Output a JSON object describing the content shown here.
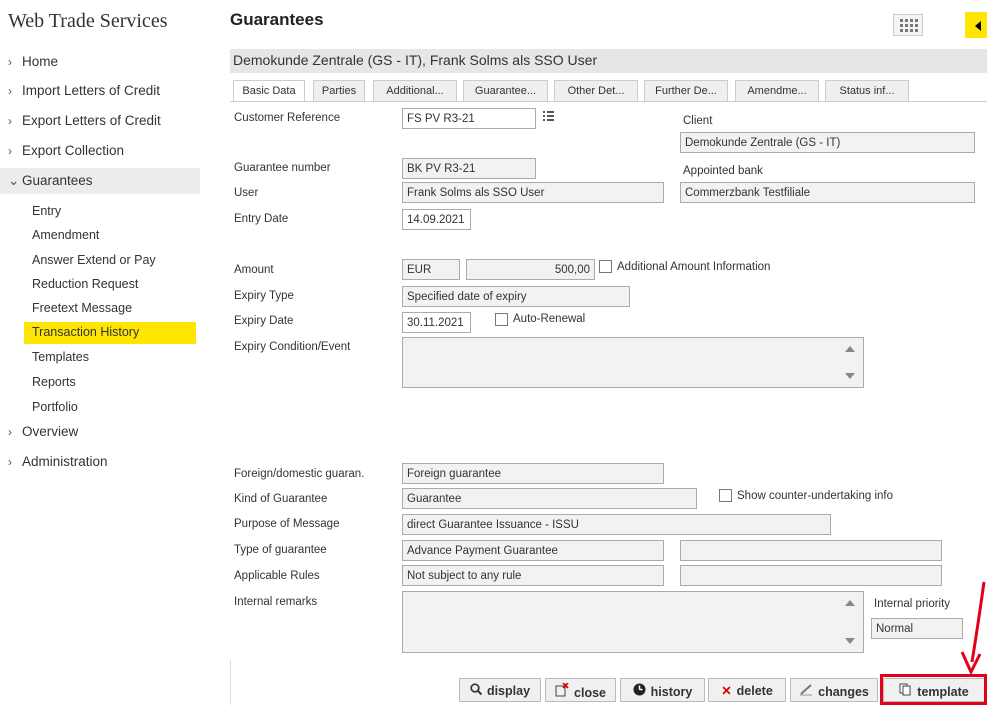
{
  "app_title": "Web Trade Services",
  "page_title": "Guarantees",
  "customer_bar": "Demokunde Zentrale (GS - IT), Frank Solms als SSO User",
  "sidebar": {
    "top_items": [
      {
        "label": "Home"
      },
      {
        "label": "Import Letters of Credit"
      },
      {
        "label": "Export Letters of Credit"
      },
      {
        "label": "Export Collection"
      }
    ],
    "group": {
      "label": "Guarantees"
    },
    "sub_items": [
      {
        "label": "Entry"
      },
      {
        "label": "Amendment"
      },
      {
        "label": "Answer Extend or Pay"
      },
      {
        "label": "Reduction Request"
      },
      {
        "label": "Freetext Message"
      },
      {
        "label": "Transaction History",
        "active": true
      },
      {
        "label": "Templates"
      },
      {
        "label": "Reports"
      },
      {
        "label": "Portfolio"
      }
    ],
    "bottom_items": [
      {
        "label": "Overview"
      },
      {
        "label": "Administration"
      }
    ]
  },
  "tabs": [
    {
      "label": "Basic Data",
      "active": true
    },
    {
      "label": "Parties"
    },
    {
      "label": "Additional..."
    },
    {
      "label": "Guarantee..."
    },
    {
      "label": "Other Det..."
    },
    {
      "label": "Further De..."
    },
    {
      "label": "Amendme..."
    },
    {
      "label": "Status inf..."
    }
  ],
  "form": {
    "customer_reference": {
      "label": "Customer Reference",
      "value": "FS PV R3-21"
    },
    "client": {
      "label": "Client",
      "value": "Demokunde Zentrale (GS - IT)"
    },
    "guarantee_number": {
      "label": "Guarantee number",
      "value": "BK PV R3-21"
    },
    "appointed_bank": {
      "label": "Appointed bank",
      "value": "Commerzbank Testfiliale"
    },
    "user": {
      "label": "User",
      "value": "Frank Solms als SSO User"
    },
    "entry_date": {
      "label": "Entry Date",
      "value": "14.09.2021"
    },
    "amount": {
      "label": "Amount",
      "currency": "EUR",
      "value": "500,00"
    },
    "additional_amount_info": {
      "label": "Additional Amount Information",
      "checked": false
    },
    "expiry_type": {
      "label": "Expiry Type",
      "value": "Specified date of expiry"
    },
    "expiry_date": {
      "label": "Expiry Date",
      "value": "30.11.2021"
    },
    "auto_renewal": {
      "label": "Auto-Renewal",
      "checked": false
    },
    "expiry_condition": {
      "label": "Expiry Condition/Event",
      "value": ""
    },
    "foreign_domestic": {
      "label": "Foreign/domestic guaran.",
      "value": "Foreign guarantee"
    },
    "kind_of_guarantee": {
      "label": "Kind of Guarantee",
      "value": "Guarantee"
    },
    "show_counter": {
      "label": "Show counter-undertaking info",
      "checked": false
    },
    "purpose_of_message": {
      "label": "Purpose of Message",
      "value": "direct Guarantee Issuance - ISSU"
    },
    "type_of_guarantee": {
      "label": "Type of guarantee",
      "value": "Advance Payment Guarantee",
      "extra": ""
    },
    "applicable_rules": {
      "label": "Applicable Rules",
      "value": "Not subject to any rule",
      "extra": ""
    },
    "internal_remarks": {
      "label": "Internal remarks",
      "value": ""
    },
    "internal_priority": {
      "label": "Internal priority",
      "value": "Normal"
    }
  },
  "actions": [
    {
      "label": "display",
      "icon": "search-icon"
    },
    {
      "label": "close",
      "icon": "close-doc-icon"
    },
    {
      "label": "history",
      "icon": "history-icon"
    },
    {
      "label": "delete",
      "icon": "delete-icon"
    },
    {
      "label": "changes",
      "icon": "changes-icon"
    },
    {
      "label": "template",
      "icon": "template-icon"
    }
  ],
  "colors": {
    "accent": "#ffe600",
    "highlight": "#e3001b"
  }
}
